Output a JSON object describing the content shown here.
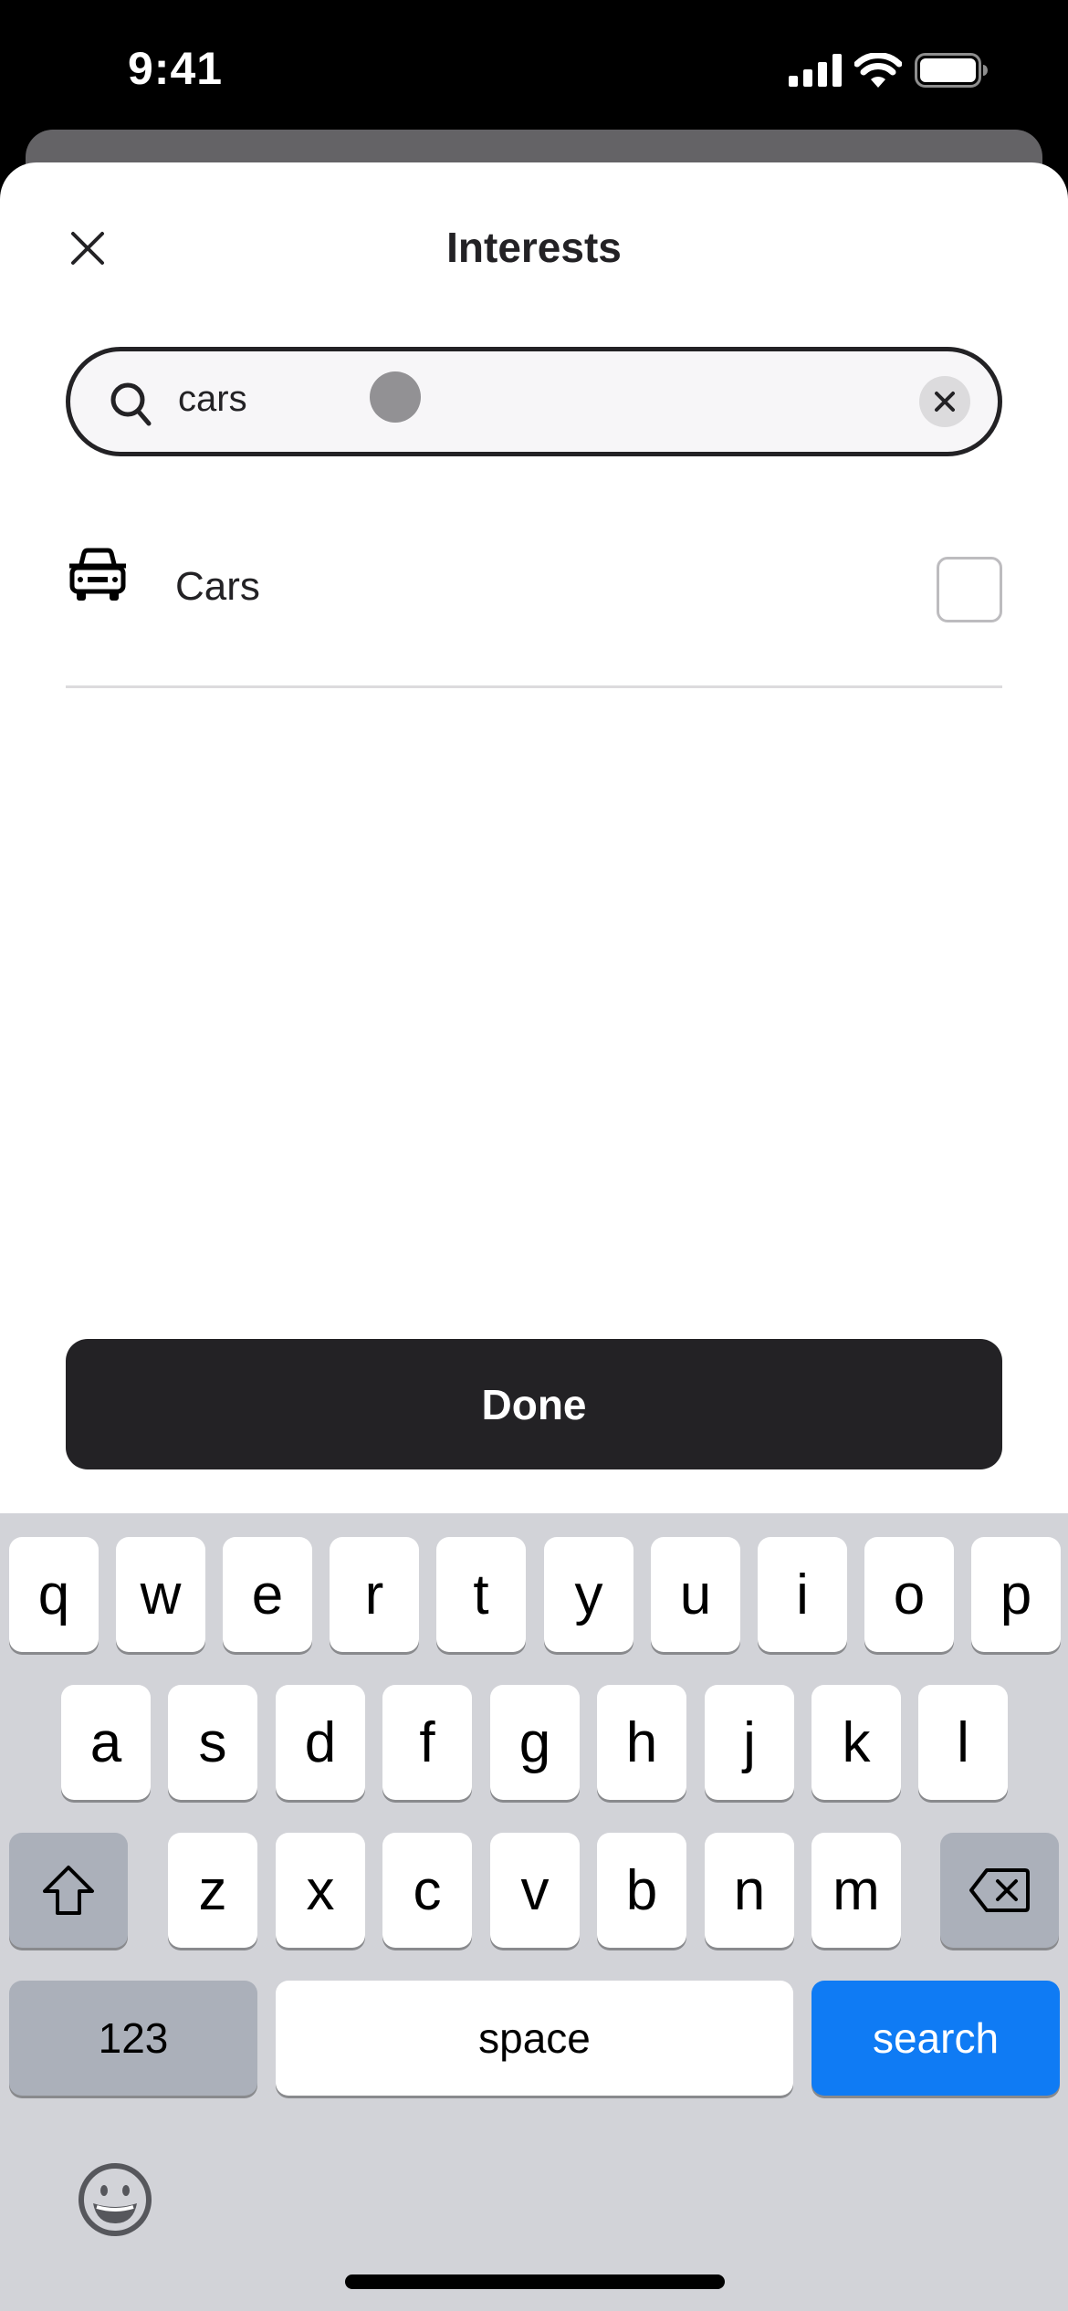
{
  "status_bar": {
    "time": "9:41",
    "icons": [
      "signal-icon",
      "wifi-icon",
      "battery-icon"
    ]
  },
  "header": {
    "title": "Interests",
    "close_icon": "close-icon"
  },
  "search": {
    "value": "cars",
    "placeholder": "",
    "search_icon": "search-icon",
    "clear_icon": "clear-icon"
  },
  "results": [
    {
      "icon": "car-icon",
      "label": "Cars",
      "checked": false
    }
  ],
  "done_label": "Done",
  "keyboard": {
    "row1": [
      "q",
      "w",
      "e",
      "r",
      "t",
      "y",
      "u",
      "i",
      "o",
      "p"
    ],
    "row2": [
      "a",
      "s",
      "d",
      "f",
      "g",
      "h",
      "j",
      "k",
      "l"
    ],
    "row3": [
      "z",
      "x",
      "c",
      "v",
      "b",
      "n",
      "m"
    ],
    "numbers_label": "123",
    "space_label": "space",
    "action_label": "search",
    "action_color": "#0f7bf4"
  },
  "colors": {
    "primary_dark": "#232225",
    "keyboard_bg": "#d2d3d8"
  }
}
